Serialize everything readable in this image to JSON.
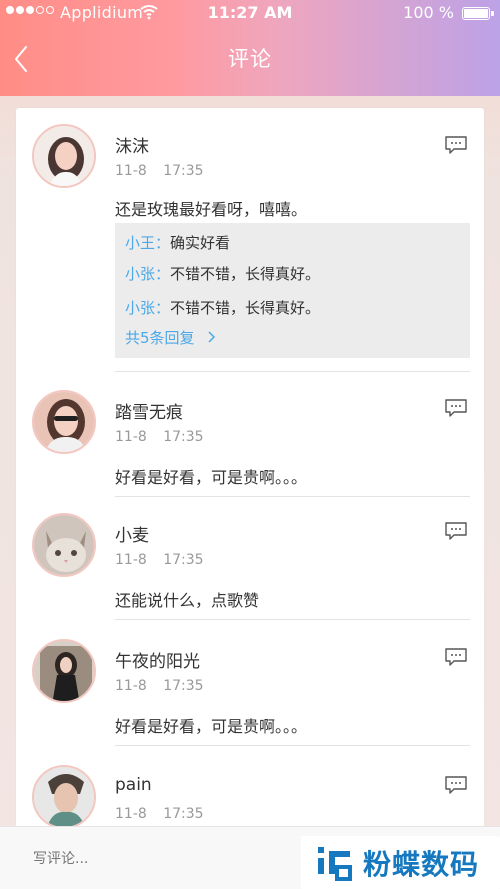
{
  "status_bar": {
    "carrier": "Applidium",
    "time": "11:27 AM",
    "battery": "100 %"
  },
  "nav": {
    "title": "评论",
    "back_icon": "chevron-left"
  },
  "comments": [
    {
      "author": "沫沫",
      "date": "11-8",
      "time": "17:35",
      "text": "还是玫瑰最好看呀，嘻嘻。",
      "replies": [
        {
          "name": "小王",
          "colon": "：",
          "text": "确实好看"
        },
        {
          "name": "小张",
          "colon": "：",
          "text": "不错不错，长得真好。"
        },
        {
          "name": "小张",
          "colon": "：",
          "text": "不错不错，长得真好。"
        }
      ],
      "more_replies_label": "共5条回复"
    },
    {
      "author": "踏雪无痕",
      "date": "11-8",
      "time": "17:35",
      "text": "好看是好看，可是贵啊。。。"
    },
    {
      "author": "小麦",
      "date": "11-8",
      "time": "17:35",
      "text": "还能说什么，点歌赞"
    },
    {
      "author": "午夜的阳光",
      "date": "11-8",
      "time": "17:35",
      "text": "好看是好看，可是贵啊。。。"
    },
    {
      "author": "pain",
      "date": "11-8",
      "time": "17:35",
      "text": ""
    }
  ],
  "input": {
    "placeholder": "写评论..."
  },
  "watermark": {
    "text": "粉蝶数码"
  },
  "colors": {
    "accent": "#4ca8e7",
    "header_start": "#ff8d86",
    "header_end": "#bca2e7"
  }
}
